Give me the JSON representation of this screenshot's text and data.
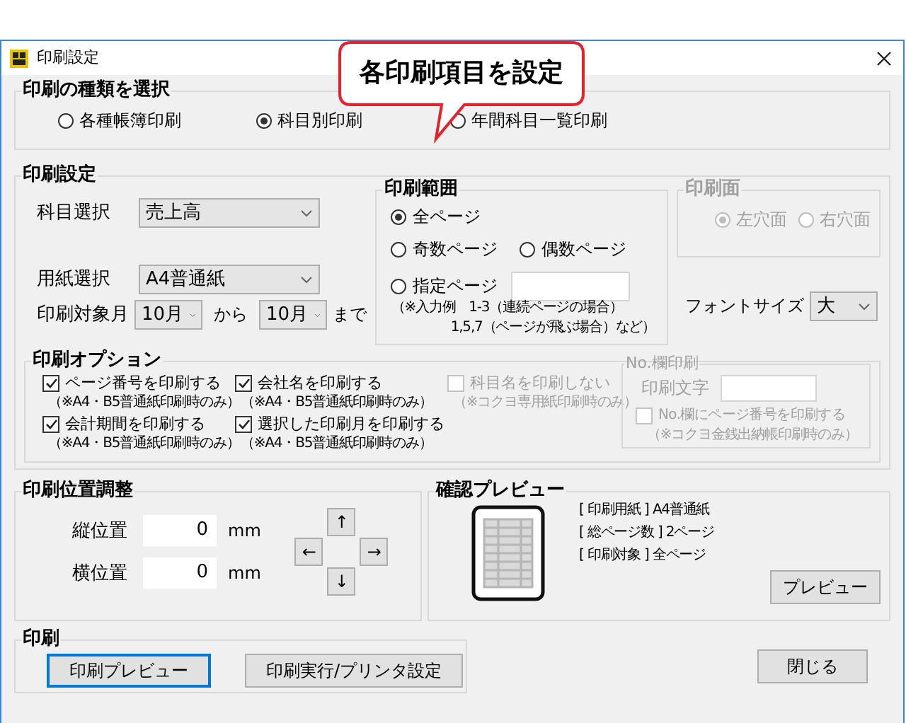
{
  "callout": {
    "text": "各印刷項目を設定"
  },
  "window": {
    "title": "印刷設定"
  },
  "print_type": {
    "title": "印刷の種類を選択",
    "options": [
      {
        "label": "各種帳簿印刷",
        "selected": false
      },
      {
        "label": "科目別印刷",
        "selected": true
      },
      {
        "label": "年間科目一覧印刷",
        "selected": false
      }
    ]
  },
  "print_settings": {
    "title": "印刷設定",
    "fields": [
      {
        "label": "科目選択",
        "value": "売上高"
      },
      {
        "label": "用紙選択",
        "value": "A4普通紙"
      }
    ],
    "month": {
      "label": "印刷対象月",
      "from": "10月",
      "from_word": "から",
      "to": "10月",
      "to_word": "まで"
    },
    "range": {
      "title": "印刷範囲",
      "rows": [
        [
          {
            "label": "全ページ",
            "selected": true,
            "kind": "plain"
          }
        ],
        [
          {
            "label": "奇数ページ",
            "selected": false,
            "kind": "plain"
          },
          {
            "label": "偶数ページ",
            "selected": false,
            "kind": "plain"
          }
        ],
        [
          {
            "label": "指定ページ",
            "selected": false,
            "kind": "with_field"
          }
        ]
      ],
      "note_lines": [
        "（※入力例　1-3（連続ページの場合）",
        "1,5,7（ページが飛ぶ場合）など）"
      ]
    },
    "side": {
      "title": "印刷面",
      "disabled": true,
      "options": [
        {
          "label": "左穴面",
          "selected": true
        },
        {
          "label": "右穴面",
          "selected": false
        }
      ]
    },
    "font_size": {
      "label": "フォントサイズ",
      "value": "大"
    },
    "options": {
      "title": "印刷オプション",
      "items": [
        {
          "label": "ページ番号を印刷する",
          "note": "（※A4・B5普通紙印刷時のみ）",
          "checked": true,
          "disabled": false
        },
        {
          "label": "会社名を印刷する",
          "note": "（※A4・B5普通紙印刷時のみ）",
          "checked": true,
          "disabled": false
        },
        {
          "label": "科目名を印刷しない",
          "note": "（※コクヨ専用紙印刷時のみ）",
          "checked": false,
          "disabled": true
        },
        {
          "label": "会計期間を印刷する",
          "note": "（※A4・B5普通紙印刷時のみ）",
          "checked": true,
          "disabled": false
        },
        {
          "label": "選択した印刷月を印刷する",
          "note": "（※A4・B5普通紙印刷時のみ）",
          "checked": true,
          "disabled": false
        }
      ]
    },
    "no_column": {
      "title": "No.欄印刷",
      "disabled": true,
      "field_label": "印刷文字",
      "checkbox": {
        "label": "No.欄にページ番号を印刷する",
        "checked": false
      },
      "note": "（※コクヨ金銭出納帳印刷時のみ）"
    }
  },
  "position": {
    "title": "印刷位置調整",
    "rows": [
      {
        "label": "縦位置",
        "value": "0",
        "unit": "mm"
      },
      {
        "label": "横位置",
        "value": "0",
        "unit": "mm"
      }
    ],
    "arrows": {
      "up": "↑",
      "left": "←",
      "right": "→",
      "down": "↓"
    }
  },
  "preview": {
    "title": "確認プレビュー",
    "lines": [
      "[ 印刷用紙 ] A4普通紙",
      "[ 総ページ数 ] 2ページ",
      "[ 印刷対象 ] 全ページ"
    ],
    "button": "プレビュー"
  },
  "print": {
    "title": "印刷",
    "buttons": [
      {
        "label": "印刷プレビュー",
        "selected": true
      },
      {
        "label": "印刷実行/プリンタ設定",
        "selected": false
      }
    ]
  },
  "close_button": "閉じる"
}
